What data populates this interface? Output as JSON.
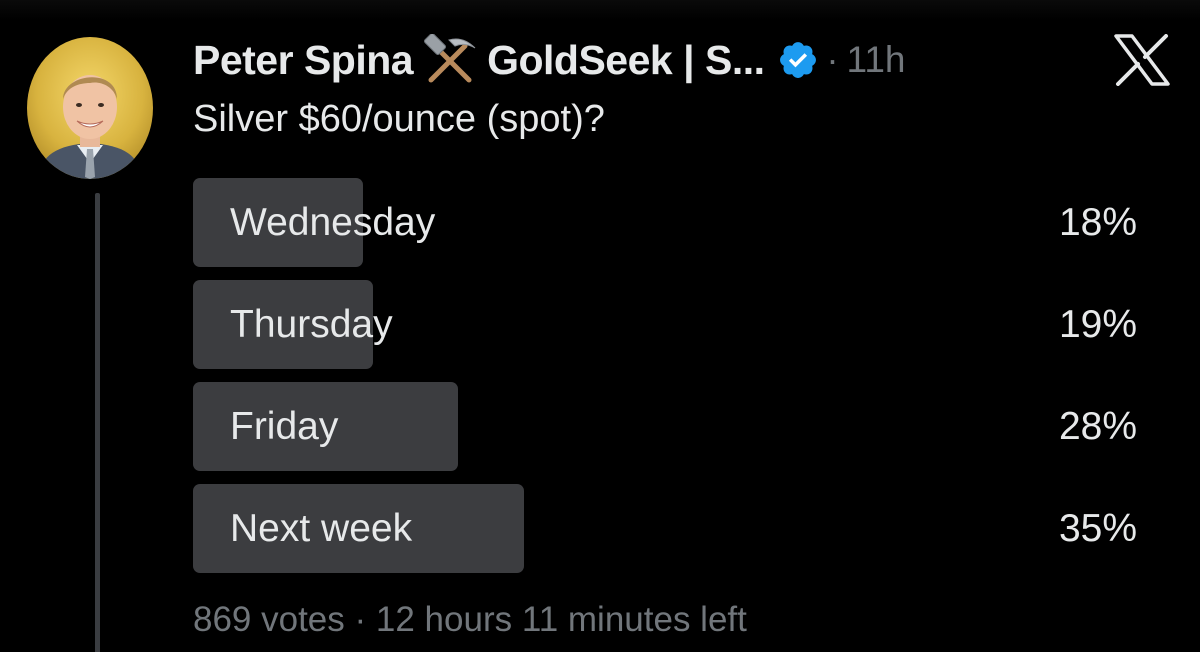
{
  "tweet": {
    "author_name": "Peter Spina",
    "author_emoji": "hammer-and-pick-icon",
    "handle_truncated": "GoldSeek | S...",
    "verified_color": "#1d9bf0",
    "dot": "·",
    "time": "11h",
    "text": "Silver $60/ounce (spot)?"
  },
  "poll": {
    "options": [
      {
        "label": "Wednesday",
        "percent_text": "18%",
        "percent": 18
      },
      {
        "label": "Thursday",
        "percent_text": "19%",
        "percent": 19
      },
      {
        "label": "Friday",
        "percent_text": "28%",
        "percent": 28
      },
      {
        "label": "Next week",
        "percent_text": "35%",
        "percent": 35
      }
    ],
    "votes": "869 votes",
    "separator": "·",
    "time_left": "12 hours 11 minutes left",
    "bar_color": "#3c3d40"
  },
  "controls": {
    "close_icon": "x-logo-icon"
  },
  "colors": {
    "background": "#000000",
    "text_primary": "#e7e9ea",
    "text_secondary": "#71767b"
  }
}
